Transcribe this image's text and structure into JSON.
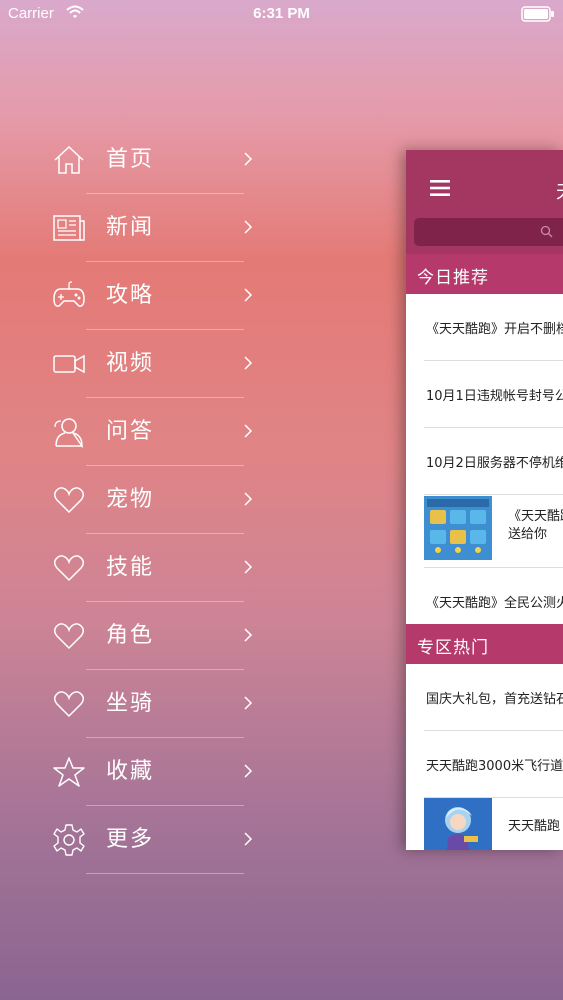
{
  "status_bar": {
    "carrier": "Carrier",
    "time": "6:31 PM"
  },
  "menu": {
    "items": [
      {
        "label": "首页",
        "icon": "home-icon"
      },
      {
        "label": "新闻",
        "icon": "newspaper-icon"
      },
      {
        "label": "攻略",
        "icon": "gamepad-icon"
      },
      {
        "label": "视频",
        "icon": "video-camera-icon"
      },
      {
        "label": "问答",
        "icon": "person-question-icon"
      },
      {
        "label": "宠物",
        "icon": "heart-icon"
      },
      {
        "label": "技能",
        "icon": "heart-icon"
      },
      {
        "label": "角色",
        "icon": "heart-icon"
      },
      {
        "label": "坐骑",
        "icon": "heart-icon"
      },
      {
        "label": "收藏",
        "icon": "star-icon"
      },
      {
        "label": "更多",
        "icon": "gear-icon"
      }
    ]
  },
  "panel": {
    "nav_title": "天",
    "section_today": "今日推荐",
    "today_rows": [
      "《天天酷跑》开启不删档",
      "10月1日违规帐号封号公",
      "10月2日服务器不停机维",
      "《天天酷跑",
      "送给你",
      "《天天酷跑》全民公测火"
    ],
    "section_hot": "专区热门",
    "hot_rows": [
      "国庆大礼包，首充送钻石",
      "天天酷跑3000米飞行道",
      "天天酷跑"
    ]
  },
  "colors": {
    "nav_bar": "#a43662",
    "section_header": "#b53a6b",
    "search_field": "#80234a"
  }
}
